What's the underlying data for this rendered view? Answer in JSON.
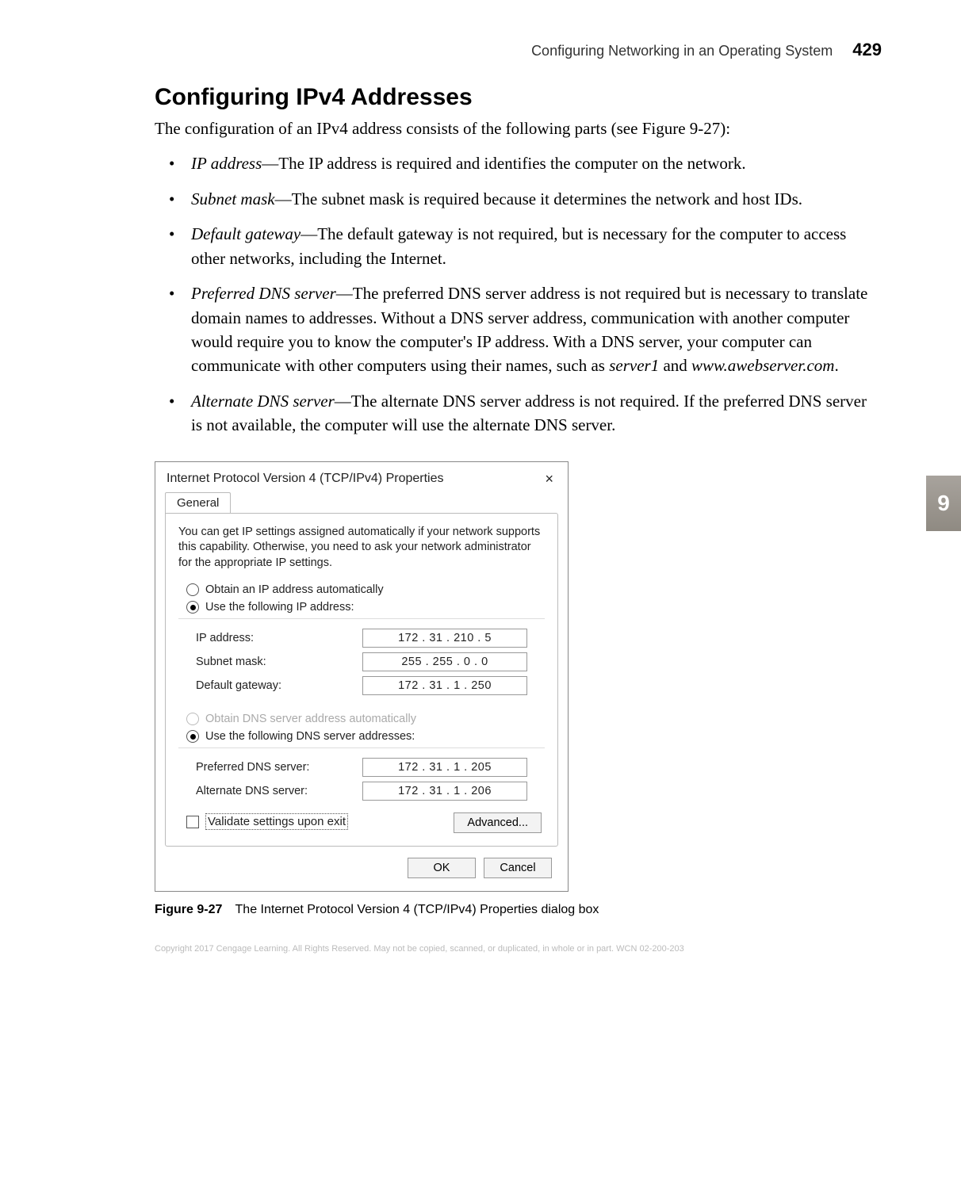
{
  "header": {
    "running": "Configuring Networking in an Operating System",
    "page_number": "429"
  },
  "section": {
    "title": "Configuring IPv4 Addresses",
    "lead": "The configuration of an IPv4 address consists of the following parts (see Figure 9-27):"
  },
  "bullets": [
    {
      "term": "IP address",
      "rest": "—The IP address is required and identifies the computer on the network."
    },
    {
      "term": "Subnet mask",
      "rest": "—The subnet mask is required because it determines the network and host IDs."
    },
    {
      "term": "Default gateway",
      "rest": "—The default gateway is not required, but is necessary for the computer to access other networks, including the Internet."
    },
    {
      "term": "Preferred DNS server",
      "rest": "—The preferred DNS server address is not required but is necessary to translate domain names to addresses. Without a DNS server address, communication with another computer would require you to know the computer's IP address. With a DNS server, your computer can communicate with other computers using their names, such as ",
      "ex1": "server1",
      "mid": " and ",
      "ex2": "www.awebserver.com",
      "tail": "."
    },
    {
      "term": "Alternate DNS server",
      "rest": "—The alternate DNS server address is not required. If the preferred DNS server is not available, the computer will use the alternate DNS server."
    }
  ],
  "dialog": {
    "title": "Internet Protocol Version 4 (TCP/IPv4) Properties",
    "tab": "General",
    "description": "You can get IP settings assigned automatically if your network supports this capability. Otherwise, you need to ask your network administrator for the appropriate IP settings.",
    "radio_auto_ip": "Obtain an IP address automatically",
    "radio_manual_ip": "Use the following IP address:",
    "fields": {
      "ip_label": "IP address:",
      "ip_value": "172 . 31 . 210 .  5",
      "subnet_label": "Subnet mask:",
      "subnet_value": "255 . 255 .  0  .  0",
      "gateway_label": "Default gateway:",
      "gateway_value": "172 . 31 .  1  . 250"
    },
    "radio_auto_dns": "Obtain DNS server address automatically",
    "radio_manual_dns": "Use the following DNS server addresses:",
    "dns_fields": {
      "pref_label": "Preferred DNS server:",
      "pref_value": "172 . 31 .  1  . 205",
      "alt_label": "Alternate DNS server:",
      "alt_value": "172 . 31 .  1  . 206"
    },
    "validate_label": "Validate settings upon exit",
    "advanced": "Advanced...",
    "ok": "OK",
    "cancel": "Cancel"
  },
  "figure": {
    "label": "Figure 9-27",
    "caption": "The Internet Protocol Version 4 (TCP/IPv4) Properties dialog box"
  },
  "copyright": "Copyright 2017 Cengage Learning. All Rights Reserved. May not be copied, scanned, or duplicated, in whole or in part.  WCN 02-200-203",
  "chapter_tab": "9"
}
